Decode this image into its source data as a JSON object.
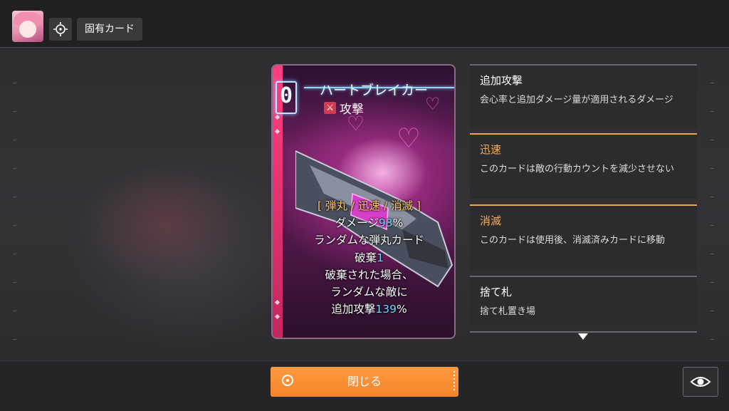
{
  "header": {
    "chip_label": "固有カード",
    "avatar_icon": "character-portrait",
    "target_icon": "target-icon"
  },
  "card": {
    "cost": "0",
    "name": "ハートブレイカー",
    "type": "攻撃",
    "type_icon": "crossed-swords-icon",
    "keywords_line": "[ 弾丸 / 迅速 / 消滅 ]",
    "lines": {
      "damage_prefix": "ダメージ",
      "damage_value": "93",
      "damage_suffix": "%",
      "line2": "ランダムな弾丸カード",
      "discard_prefix": "破棄",
      "discard_value": "1",
      "line4": "破棄された場合、",
      "line5": "ランダムな敵に",
      "extra_prefix": "追加攻撃",
      "extra_value": "139",
      "extra_suffix": "%"
    },
    "colors": {
      "keyword": "#ffc56b",
      "number": "#6fd8ff",
      "stripe": "#ff3f7f"
    }
  },
  "keyword_panels": [
    {
      "title": "追加攻撃",
      "desc": "会心率と追加ダメージ量が適用されるダメージ",
      "accent": false
    },
    {
      "title": "迅速",
      "desc": "このカードは敵の行動カウントを減少させない",
      "accent": true
    },
    {
      "title": "消滅",
      "desc": "このカードは使用後、消滅済みカードに移動",
      "accent": true
    },
    {
      "title": "捨て札",
      "desc": "捨て札置き場",
      "accent": false
    }
  ],
  "footer": {
    "close_label": "閉じる",
    "eye_icon": "eye-icon",
    "accent_color": "#f3852c"
  }
}
